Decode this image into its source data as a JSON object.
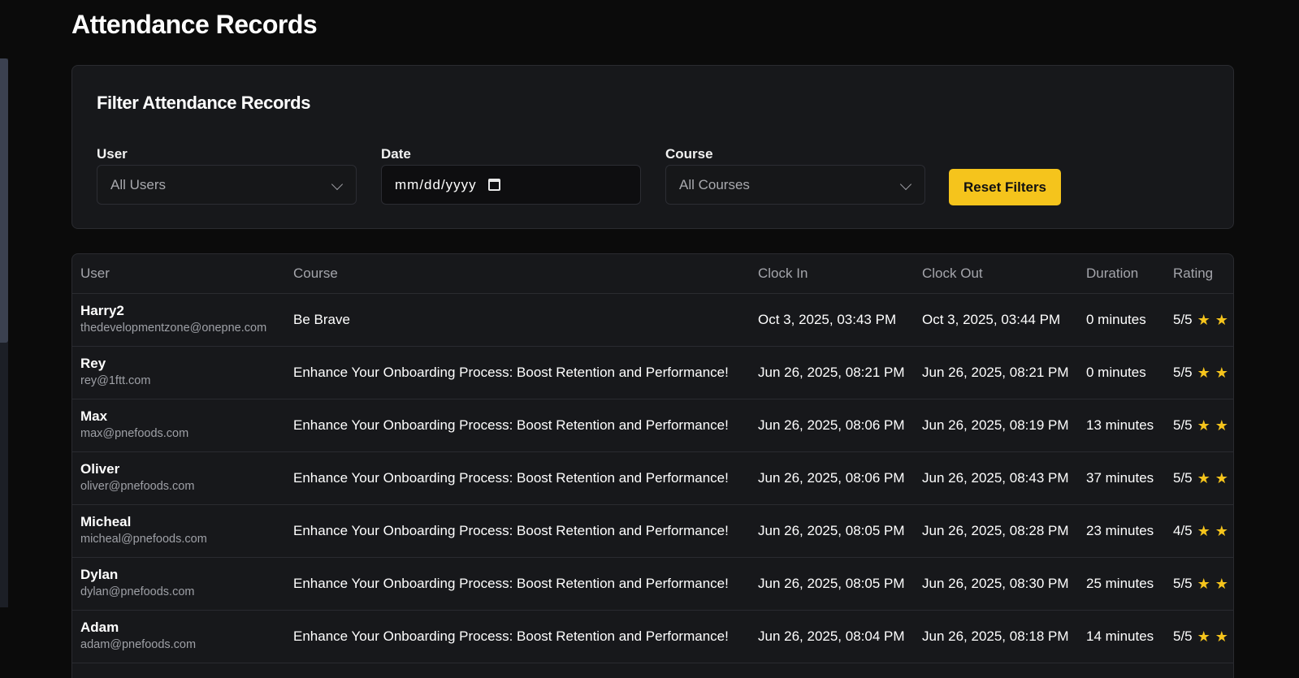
{
  "page": {
    "title": "Attendance Records"
  },
  "filters": {
    "title": "Filter Attendance Records",
    "user": {
      "label": "User",
      "value": "All Users"
    },
    "date": {
      "label": "Date",
      "value": "mm/dd/yyyy"
    },
    "course": {
      "label": "Course",
      "value": "All Courses"
    },
    "reset_label": "Reset Filters"
  },
  "colors": {
    "accent": "#f5c41c",
    "background": "#0b0b0b",
    "card": "#17181b"
  },
  "table": {
    "headers": [
      "User",
      "Course",
      "Clock In",
      "Clock Out",
      "Duration",
      "Rating"
    ],
    "rows": [
      {
        "name": "Harry2",
        "email": "thedevelopmentzone@onepne.com",
        "course": "Be Brave",
        "clock_in": "Oct 3, 2025, 03:43 PM",
        "clock_out": "Oct 3, 2025, 03:44 PM",
        "duration": "0 minutes",
        "rating": "5/5"
      },
      {
        "name": "Rey",
        "email": "rey@1ftt.com",
        "course": "Enhance Your Onboarding Process: Boost Retention and Performance!",
        "clock_in": "Jun 26, 2025, 08:21 PM",
        "clock_out": "Jun 26, 2025, 08:21 PM",
        "duration": "0 minutes",
        "rating": "5/5"
      },
      {
        "name": "Max",
        "email": "max@pnefoods.com",
        "course": "Enhance Your Onboarding Process: Boost Retention and Performance!",
        "clock_in": "Jun 26, 2025, 08:06 PM",
        "clock_out": "Jun 26, 2025, 08:19 PM",
        "duration": "13 minutes",
        "rating": "5/5"
      },
      {
        "name": "Oliver",
        "email": "oliver@pnefoods.com",
        "course": "Enhance Your Onboarding Process: Boost Retention and Performance!",
        "clock_in": "Jun 26, 2025, 08:06 PM",
        "clock_out": "Jun 26, 2025, 08:43 PM",
        "duration": "37 minutes",
        "rating": "5/5"
      },
      {
        "name": "Micheal",
        "email": "micheal@pnefoods.com",
        "course": "Enhance Your Onboarding Process: Boost Retention and Performance!",
        "clock_in": "Jun 26, 2025, 08:05 PM",
        "clock_out": "Jun 26, 2025, 08:28 PM",
        "duration": "23 minutes",
        "rating": "4/5"
      },
      {
        "name": "Dylan",
        "email": "dylan@pnefoods.com",
        "course": "Enhance Your Onboarding Process: Boost Retention and Performance!",
        "clock_in": "Jun 26, 2025, 08:05 PM",
        "clock_out": "Jun 26, 2025, 08:30 PM",
        "duration": "25 minutes",
        "rating": "5/5"
      },
      {
        "name": "Adam",
        "email": "adam@pnefoods.com",
        "course": "Enhance Your Onboarding Process: Boost Retention and Performance!",
        "clock_in": "Jun 26, 2025, 08:04 PM",
        "clock_out": "Jun 26, 2025, 08:18 PM",
        "duration": "14 minutes",
        "rating": "5/5"
      }
    ]
  }
}
